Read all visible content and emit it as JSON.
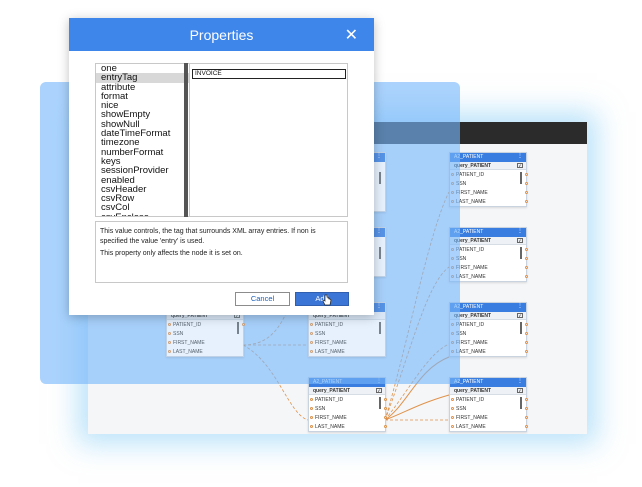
{
  "dialog": {
    "title": "Properties",
    "close_icon": "close-icon",
    "properties": [
      "one",
      "entryTag",
      "attribute",
      "format",
      "nice",
      "showEmpty",
      "showNull",
      "dateTimeFormat",
      "timezone",
      "numberFormat",
      "keys",
      "sessionProvider",
      "enabled",
      "csvHeader",
      "csvRow",
      "csvCol",
      "csvEnclose"
    ],
    "selected_property": "entryTag",
    "value": "INVOICE",
    "description": [
      "This value controls, the tag that surrounds XML array entries. If non is specified the value 'entry' is used.",
      "This property only affects the node it is set on."
    ],
    "cancel_label": "Cancel",
    "add_label": "Add"
  },
  "nodes": {
    "header": "A2_PATIENT",
    "header_right": "A2_PATIENT",
    "query": "query_PATIENT",
    "query_partial": "query_PATIENT",
    "fields": [
      "PATIENT_ID",
      "SSN",
      "FIRST_NAME",
      "LAST_NAME"
    ]
  },
  "colors": {
    "accent": "#3f86ea",
    "node_header": "#3a7de0",
    "link": "#e0924a"
  }
}
